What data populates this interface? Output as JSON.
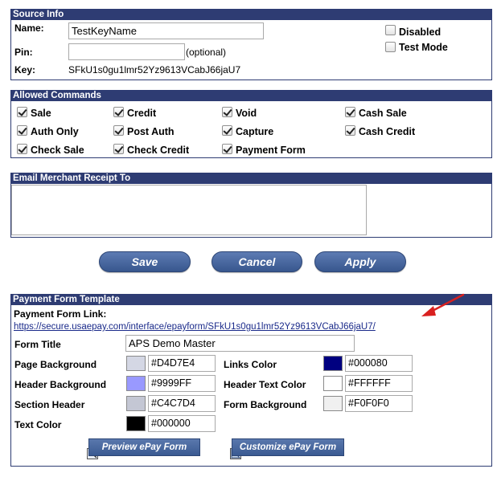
{
  "source_info": {
    "header": "Source Info",
    "name_label": "Name:",
    "name_value": "TestKeyName",
    "pin_label": "Pin:",
    "pin_value": "",
    "pin_hint": "(optional)",
    "key_label": "Key:",
    "key_value": "SFkU1s0gu1lmr52Yz9613VCabJ66jaU7",
    "disabled_label": "Disabled",
    "disabled_checked": false,
    "testmode_label": "Test Mode",
    "testmode_checked": false
  },
  "allowed_commands": {
    "header": "Allowed Commands",
    "items": [
      {
        "label": "Sale",
        "checked": true
      },
      {
        "label": "Credit",
        "checked": true
      },
      {
        "label": "Void",
        "checked": true
      },
      {
        "label": "Cash Sale",
        "checked": true
      },
      {
        "label": "Auth Only",
        "checked": true
      },
      {
        "label": "Post Auth",
        "checked": true
      },
      {
        "label": "Capture",
        "checked": true
      },
      {
        "label": "Cash Credit",
        "checked": true
      },
      {
        "label": "Check Sale",
        "checked": true
      },
      {
        "label": "Check Credit",
        "checked": true
      },
      {
        "label": "Payment Form",
        "checked": true
      }
    ]
  },
  "email_receipt": {
    "header": "Email Merchant Receipt To",
    "value": ""
  },
  "actions": {
    "save": "Save",
    "cancel": "Cancel",
    "apply": "Apply"
  },
  "payment_form": {
    "header": "Payment Form Template",
    "link_label": "Payment Form Link:",
    "link_url": "https://secure.usaepay.com/interface/epayform/SFkU1s0gu1lmr52Yz9613VCabJ66jaU7/",
    "form_title_label": "Form Title",
    "form_title_value": "APS Demo Master",
    "page_bg_label": "Page Background",
    "page_bg_value": "#D4D7E4",
    "header_bg_label": "Header Background",
    "header_bg_value": "#9999FF",
    "section_header_label": "Section Header",
    "section_header_value": "#C4C7D4",
    "text_color_label": "Text Color",
    "text_color_value": "#000000",
    "links_color_label": "Links Color",
    "links_color_value": "#000080",
    "header_text_color_label": "Header Text Color",
    "header_text_color_value": "#FFFFFF",
    "form_bg_label": "Form Background",
    "form_bg_value": "#F0F0F0",
    "preview_button": "Preview ePay Form",
    "customize_button": "Customize ePay Form"
  },
  "colors": {
    "panel_header": "#2e3c73",
    "link": "#1a2a8a",
    "annotation_arrow": "#d9201f"
  }
}
